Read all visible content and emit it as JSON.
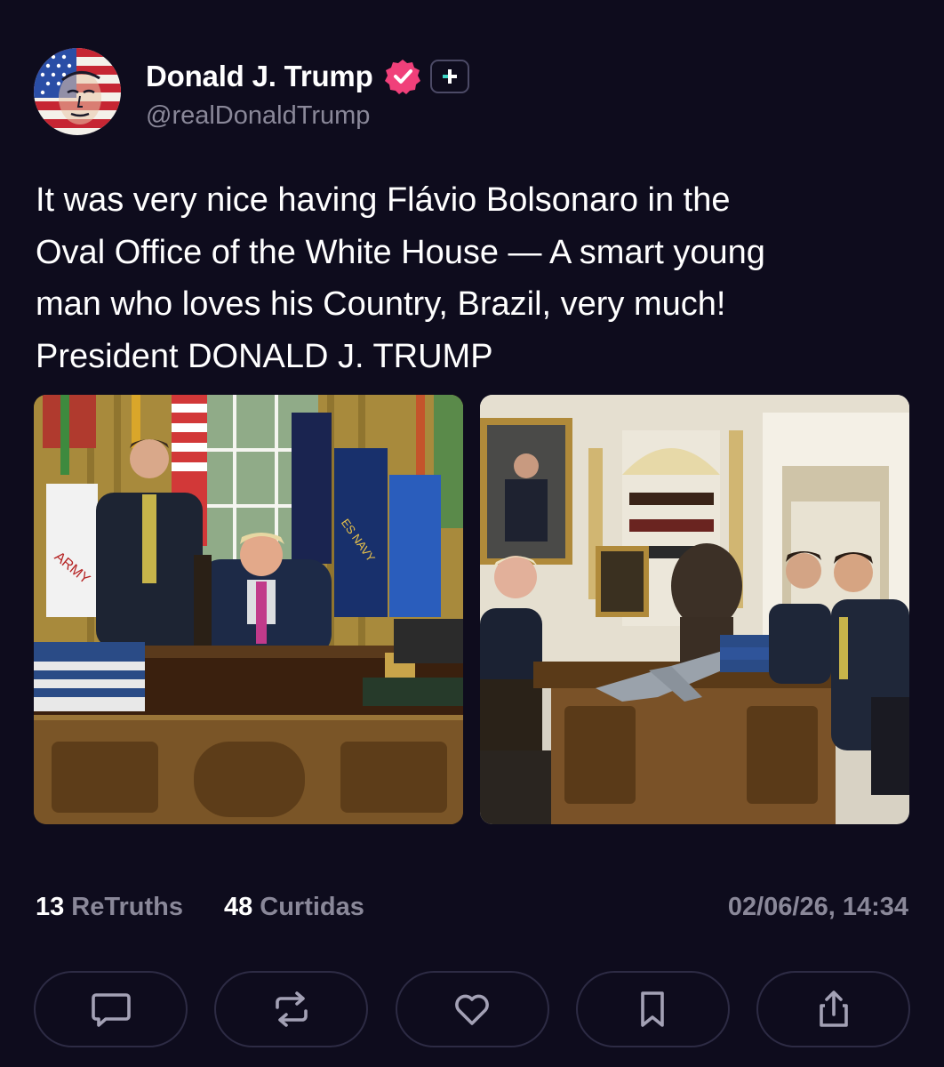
{
  "author": {
    "display_name": "Donald J. Trump",
    "handle": "@realDonaldTrump",
    "avatar_icon": "flag-portrait-avatar",
    "verified_icon": "verified-badge-icon",
    "verified_color": "#f0407a",
    "follow_icon": "plus-icon",
    "follow_icon_color": "#3fd6c6"
  },
  "post": {
    "text": "It was very nice having Flávio Bolsonaro in the\nOval Office of the White House — A smart young\nman who loves his Country, Brazil, very much!\nPresident DONALD J. TRUMP"
  },
  "media": [
    {
      "kind": "photo",
      "subject": "oval-office-desk-photo"
    },
    {
      "kind": "photo",
      "subject": "oval-office-meeting-photo"
    }
  ],
  "stats": {
    "retruths_count": "13",
    "retruths_label": "ReTruths",
    "likes_count": "48",
    "likes_label": "Curtidas",
    "timestamp": "02/06/26, 14:34"
  },
  "actions": [
    {
      "name": "reply",
      "icon": "comment-icon"
    },
    {
      "name": "retruth",
      "icon": "repost-icon"
    },
    {
      "name": "like",
      "icon": "heart-icon"
    },
    {
      "name": "bookmark",
      "icon": "bookmark-icon"
    },
    {
      "name": "share",
      "icon": "share-icon"
    }
  ],
  "colors": {
    "background": "#0e0c1d",
    "text_primary": "#ffffff",
    "text_secondary": "#8a8899",
    "button_border": "#2d2b44",
    "icon_color": "#a3a1b5"
  }
}
